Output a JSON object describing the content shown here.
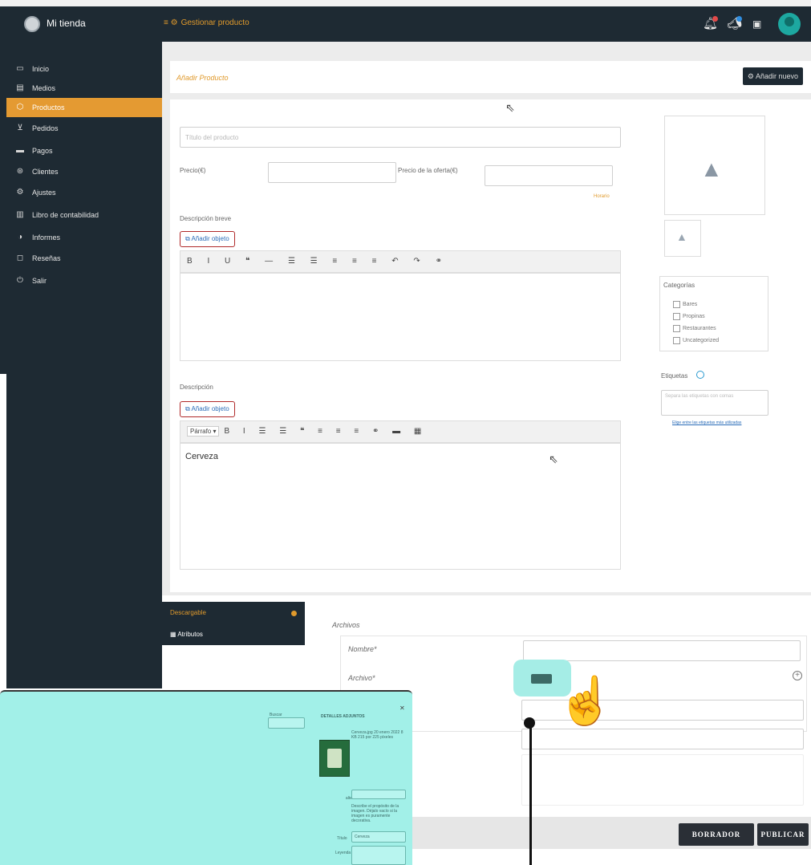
{
  "topbar": {
    "brand": "Mi tienda",
    "breadcrumb": "Gestionar producto",
    "breadcrumb_icon": "hamburger-icon"
  },
  "sidebar": {
    "items": [
      {
        "label": "Inicio",
        "icon": "monitor-icon"
      },
      {
        "label": "Medios",
        "icon": "media-icon"
      },
      {
        "label": "Productos",
        "icon": "box-icon",
        "active": true
      },
      {
        "label": "Pedidos",
        "icon": "cart-icon"
      },
      {
        "label": "Pagos",
        "icon": "card-icon"
      },
      {
        "label": "Clientes",
        "icon": "clients-icon"
      },
      {
        "label": "Ajustes",
        "icon": "settings-icon"
      },
      {
        "label": "Libro de contabilidad",
        "icon": "ledger-icon"
      },
      {
        "label": "Informes",
        "icon": "report-icon"
      },
      {
        "label": "Reseñas",
        "icon": "review-icon"
      },
      {
        "label": "Salir",
        "icon": "power-icon"
      }
    ]
  },
  "header": {
    "title": "Añadir Producto",
    "add_new": "Añadir nuevo"
  },
  "form": {
    "title_placeholder": "Título del producto",
    "price_label": "Precio(€)",
    "sale_price_label": "Precio de la oferta(€)",
    "schedule_link": "Horario",
    "short_desc_label": "Descripción breve",
    "add_object": "Añadir objeto",
    "desc_label": "Descripción",
    "paragraph_select": "Párrafo",
    "description_text": "Cerveza"
  },
  "categories": {
    "title": "Categorías",
    "items": [
      "Bares",
      "Propinas",
      "Restaurantes",
      "Uncategorized"
    ]
  },
  "tags": {
    "title": "Etiquetas",
    "placeholder": "Separa las etiquetas con comas",
    "link": "Elige entre las etiquetas más utilizadas"
  },
  "bottom": {
    "tab_downloads": "Descargable",
    "tab_attributes": "Atributos",
    "files_label": "Archivos",
    "name_label": "Nombre*",
    "file_label": "Archivo*",
    "draft_button": "BORRADOR",
    "publish_button": "PUBLICAR"
  },
  "overlay": {
    "title": "DETALLES ADJUNTOS",
    "filter_label": "Buscar",
    "alt_label": "Texto alternativo",
    "title_field_label": "Título",
    "title_value": "Cerveza",
    "caption_label": "Leyenda",
    "file_info": "Cerveza.jpg 20 enero 2022 8 KB 215 por 225 píxeles",
    "help_text": "Describe el propósito de la imagen. Déjalo vacío si la imagen es puramente decorativa."
  },
  "colors": {
    "dark": "#1e2a33",
    "accent": "#e49a32",
    "overlay": "#a2f0e8"
  }
}
